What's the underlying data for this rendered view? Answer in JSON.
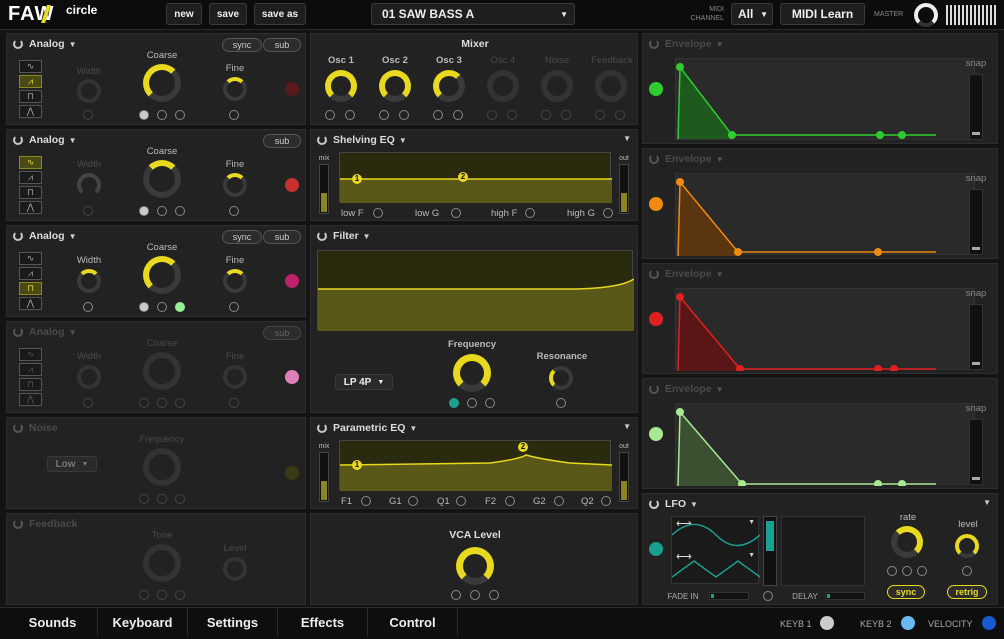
{
  "header": {
    "logo": "FAW",
    "logo_sub": "circle",
    "new": "new",
    "save": "save",
    "save_as": "save as",
    "preset": "01 SAW BASS A",
    "midi_label": "MIDI CHANNEL",
    "midi_channel": "All",
    "midi_learn": "MIDI Learn",
    "master": "MASTER"
  },
  "osc": [
    {
      "title": "Analog",
      "sync": "sync",
      "sub": "sub",
      "width": "Width",
      "coarse": "Coarse",
      "fine": "Fine"
    },
    {
      "title": "Analog",
      "sub": "sub",
      "width": "Width",
      "coarse": "Coarse",
      "fine": "Fine"
    },
    {
      "title": "Analog",
      "sync": "sync",
      "sub": "sub",
      "width": "Width",
      "coarse": "Coarse",
      "fine": "Fine"
    },
    {
      "title": "Analog",
      "sub": "sub",
      "width": "Width",
      "coarse": "Coarse",
      "fine": "Fine"
    }
  ],
  "noise": {
    "title": "Noise",
    "mode": "Low",
    "frequency": "Frequency"
  },
  "feedback": {
    "title": "Feedback",
    "tone": "Tone",
    "level": "Level"
  },
  "mixer": {
    "title": "Mixer",
    "channels": [
      "Osc 1",
      "Osc 2",
      "Osc 3",
      "Osc 4",
      "Noise",
      "Feedback"
    ]
  },
  "shelving": {
    "title": "Shelving EQ",
    "mix": "mix",
    "out": "out",
    "p1": "1",
    "p2": "2",
    "params": [
      "low F",
      "low G",
      "high F",
      "high G"
    ]
  },
  "filter": {
    "title": "Filter",
    "type": "LP 4P",
    "frequency": "Frequency",
    "resonance": "Resonance"
  },
  "parametric": {
    "title": "Parametric EQ",
    "mix": "mix",
    "out": "out",
    "p1": "1",
    "p2": "2",
    "params": [
      "F1",
      "G1",
      "Q1",
      "F2",
      "G2",
      "Q2"
    ]
  },
  "vca": {
    "title": "VCA Level"
  },
  "envelopes": [
    {
      "title": "Envelope",
      "snap": "snap"
    },
    {
      "title": "Envelope",
      "snap": "snap"
    },
    {
      "title": "Envelope",
      "snap": "snap"
    },
    {
      "title": "Envelope",
      "snap": "snap"
    }
  ],
  "lfo": {
    "title": "LFO",
    "rate": "rate",
    "level": "level",
    "sync": "sync",
    "retrig": "retrig",
    "fade_in": "FADE IN",
    "delay": "DELAY"
  },
  "tabs": [
    "Sounds",
    "Keyboard",
    "Settings",
    "Effects",
    "Control"
  ],
  "footer": {
    "keyb1": "KEYB 1",
    "keyb2": "KEYB 2",
    "velocity": "VELOCITY"
  },
  "colors": {
    "accent": "#e8d81e",
    "env1": "#2ecc2e",
    "env2": "#f08a10",
    "env3": "#e02020",
    "env4": "#a8e890",
    "lfo": "#1aa090"
  }
}
